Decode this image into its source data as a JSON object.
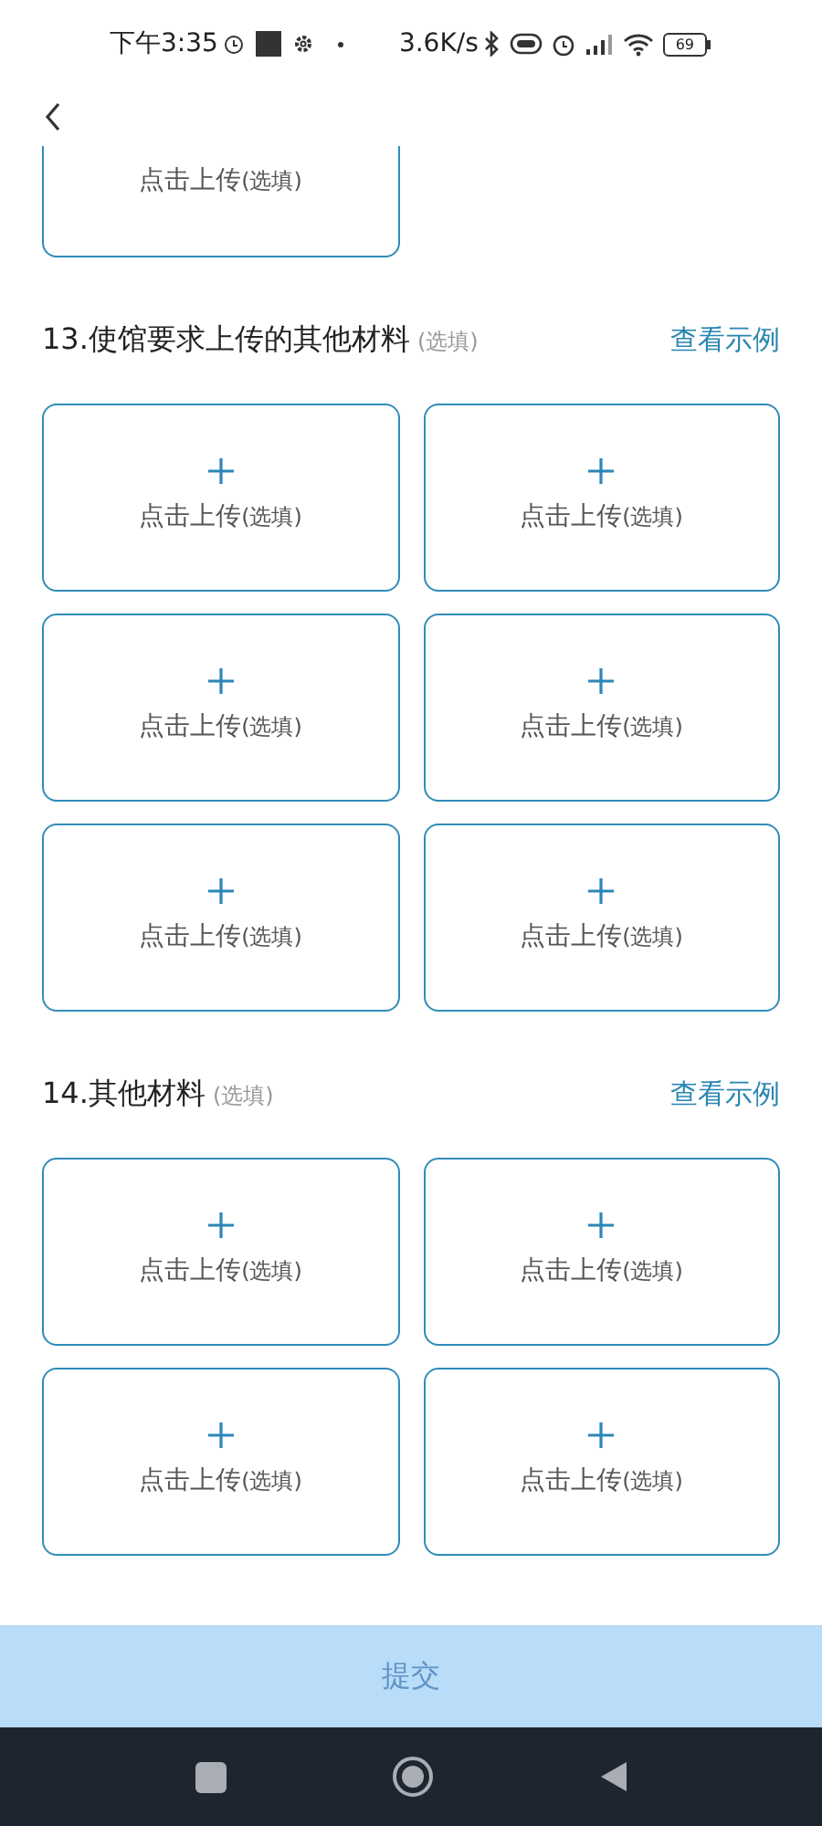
{
  "status_bar": {
    "time": "下午3:35",
    "speed": "3.6K/s",
    "battery": "69"
  },
  "partial_tile": {
    "label": "点击上传",
    "hint": "(选填)"
  },
  "sections": [
    {
      "title": "13.使馆要求上传的其他材料",
      "optional": "(选填)",
      "example_link": "查看示例",
      "tiles": [
        {
          "label": "点击上传",
          "hint": "(选填)"
        },
        {
          "label": "点击上传",
          "hint": "(选填)"
        },
        {
          "label": "点击上传",
          "hint": "(选填)"
        },
        {
          "label": "点击上传",
          "hint": "(选填)"
        },
        {
          "label": "点击上传",
          "hint": "(选填)"
        },
        {
          "label": "点击上传",
          "hint": "(选填)"
        }
      ]
    },
    {
      "title": "14.其他材料",
      "optional": "(选填)",
      "example_link": "查看示例",
      "tiles": [
        {
          "label": "点击上传",
          "hint": "(选填)"
        },
        {
          "label": "点击上传",
          "hint": "(选填)"
        },
        {
          "label": "点击上传",
          "hint": "(选填)"
        },
        {
          "label": "点击上传",
          "hint": "(选填)"
        }
      ]
    }
  ],
  "submit": {
    "label": "提交",
    "disabled": true
  }
}
